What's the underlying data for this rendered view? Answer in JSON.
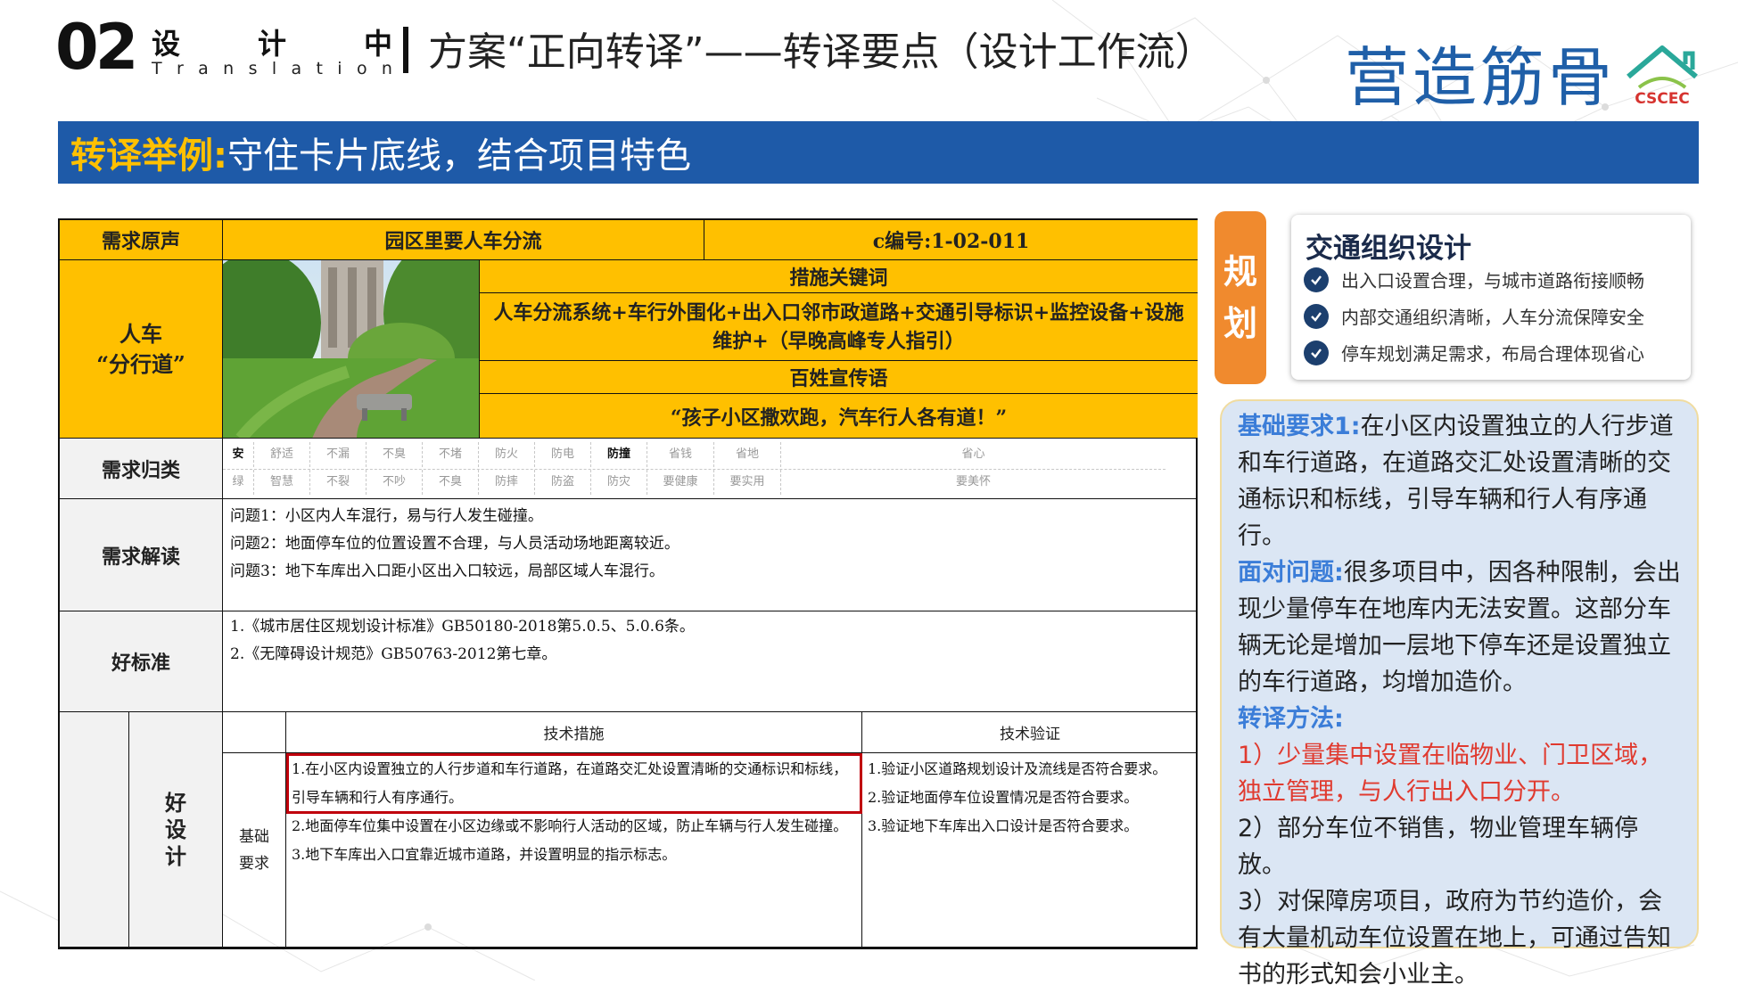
{
  "header": {
    "number": "02",
    "cn_chars": [
      "设",
      "计",
      "中"
    ],
    "en_chars": [
      "T",
      "r",
      "a",
      "n",
      "s",
      "l",
      "a",
      "t",
      "i",
      "o",
      "n"
    ],
    "title": "方案“正向转译”——转译要点（设计工作流）",
    "brand": "营造筋骨",
    "logo_text": "CSCEC"
  },
  "banner": {
    "highlight": "转译举例:",
    "rest": "守住卡片底线，结合项目特色"
  },
  "table": {
    "row1": {
      "label": "需求原声",
      "title": "园区里要人车分流",
      "code": "c编号:1-02-011"
    },
    "row2": {
      "label_line1": "人车",
      "label_line2": "“分行道”",
      "kw_header": "措施关键词",
      "kw_text": "人车分流系统+车行外围化+出入口邻市政道路+交通引导标识+监控设备+设施维护+（早晚高峰专人指引）",
      "slogan_header": "百姓宣传语",
      "slogan": "“孩子小区撒欢跑，汽车行人各有道！”"
    },
    "row3": {
      "label": "需求归类",
      "cats_top": [
        "安",
        "舒适",
        "不漏",
        "不臭",
        "不堵",
        "防火",
        "防电",
        "防撞",
        "省钱",
        "省地",
        "省心"
      ],
      "cats_bottom": [
        "绿",
        "智慧",
        "不裂",
        "不吵",
        "不臭",
        "防摔",
        "防盗",
        "防灾",
        "要健康",
        "要实用",
        "要美怀"
      ]
    },
    "row4": {
      "label": "需求解读",
      "items": [
        "问题1：小区内人车混行，易与行人发生碰撞。",
        "问题2：地面停车位的位置设置不合理，与人员活动场地距离较近。",
        "问题3：地下车库出入口距小区出入口较远，局部区域人车混行。"
      ]
    },
    "row5": {
      "label": "好标准",
      "items": [
        "1.《城市居住区规划设计标准》GB50180-2018第5.0.5、5.0.6条。",
        "2.《无障碍设计规范》GB50763-2012第七章。"
      ]
    },
    "row6": {
      "label_chars": [
        "好",
        "设",
        "计"
      ],
      "tech_header": "技术措施",
      "verify_header": "技术验证",
      "sub_label_line1": "基础",
      "sub_label_line2": "要求",
      "tech_items": [
        "1.在小区内设置独立的人行步道和车行道路，在道路交汇处设置清晰的交通标识和标线，",
        "引导车辆和行人有序通行。",
        "2.地面停车位集中设置在小区边缘或不影响行人活动的区域，防止车辆与行人发生碰撞。",
        "3.地下车库出入口宜靠近城市道路，并设置明显的指示标志。"
      ],
      "verify_items": [
        "1.验证小区道路规划设计及流线是否符合要求。",
        "2.验证地面停车位设置情况是否符合要求。",
        "3.验证地下车库出入口设计是否符合要求。"
      ]
    }
  },
  "plan_tab": {
    "chars": [
      "规",
      "划"
    ]
  },
  "card": {
    "title": "交通组织设计",
    "items": [
      "出入口设置合理，与城市道路衔接顺畅",
      "内部交通组织清晰，人车分流保障安全",
      "停车规划满足需求，布局合理体现省心"
    ]
  },
  "note": {
    "req_label": "基础要求1:",
    "req_text": "在小区内设置独立的人行步道和车行道路，在道路交汇处设置清晰的交通标识和标线，引导车辆和行人有序通行。",
    "problem_label": "面对问题:",
    "problem_text": "很多项目中，因各种限制，会出现少量停车在地库内无法安置。这部分车辆无论是增加一层地下停车还是设置独立的车行道路，均增加造价。",
    "method_label": "转译方法:",
    "method_1": "1）少量集中设置在临物业、门卫区域，独立管理，与人行出入口分开。",
    "method_2": "2）部分车位不销售，物业管理车辆停放。",
    "method_3": "3）对保障房项目，政府为节约造价，会有大量机动车位设置在地上，可通过告知书的形式知会小业主。"
  },
  "colors": {
    "banner_blue": "#1e5aa8",
    "banner_highlight": "#ffc000",
    "table_yellow": "#ffc000",
    "plan_orange": "#f08a2e",
    "note_bg": "#dbe6f4",
    "label_blue": "#3b7dd8",
    "method_red": "#e03a2f",
    "highlight_box": "#c0000c"
  }
}
